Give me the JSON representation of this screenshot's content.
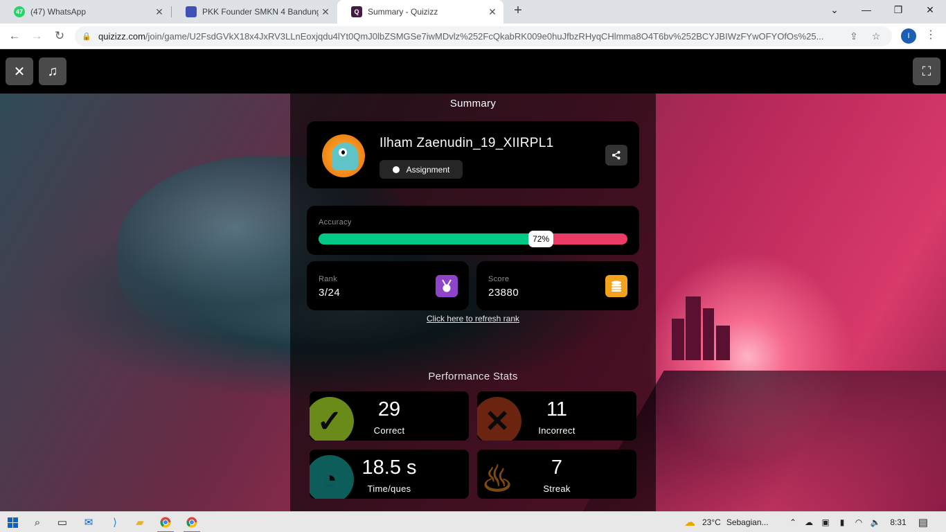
{
  "browser": {
    "tabs": [
      {
        "title": "(47) WhatsApp",
        "badge": "47",
        "close": "✕",
        "favicon_color": "#25d366"
      },
      {
        "title": "PKK Founder SMKN 4 Bandung -",
        "close": "✕",
        "favicon_color": "#3f51b5"
      },
      {
        "title": "Summary - Quizizz",
        "close": "✕",
        "favicon_color": "#461a42"
      }
    ],
    "new_tab": "+",
    "url_host": "quizizz.com",
    "url_path": "/join/game/U2FsdGVkX18x4JxRV3LLnEoxjqdu4lYt0QmJ0lbZSMGSe7iwMDvlz%252FcQkabRK009e0huJfbzRHyqCHlmma8O4T6bv%252BCYJBIWzFYwOFYOfOs%25...",
    "profile_initial": "I"
  },
  "page": {
    "summary_title": "Summary",
    "player": {
      "name": "Ilham Zaenudin_19_XIIRPL1",
      "mode_label": "Assignment"
    },
    "accuracy": {
      "label": "Accuracy",
      "value_text": "72%",
      "fraction": 0.72,
      "correct_color": "#00c985",
      "incorrect_color": "#ec3b67"
    },
    "rank": {
      "label": "Rank",
      "value": "3/24"
    },
    "score": {
      "label": "Score",
      "value": "23880"
    },
    "refresh_link": "Click here to refresh rank",
    "performance": {
      "title": "Performance Stats",
      "stats": [
        {
          "value": "29",
          "caption": "Correct",
          "icon": "check-icon",
          "color": "#6a8a1a"
        },
        {
          "value": "11",
          "caption": "Incorrect",
          "icon": "cross-icon",
          "color": "#7a2a10"
        },
        {
          "value": "18.5 s",
          "caption": "Time/ques",
          "icon": "stopwatch-icon",
          "color": "#0f6f6a"
        },
        {
          "value": "7",
          "caption": "Streak",
          "icon": "fire-icon",
          "color": "#8a5a10"
        }
      ]
    }
  },
  "taskbar": {
    "weather_temp": "23°C",
    "weather_text": "Sebagian...",
    "time": "8:31"
  }
}
